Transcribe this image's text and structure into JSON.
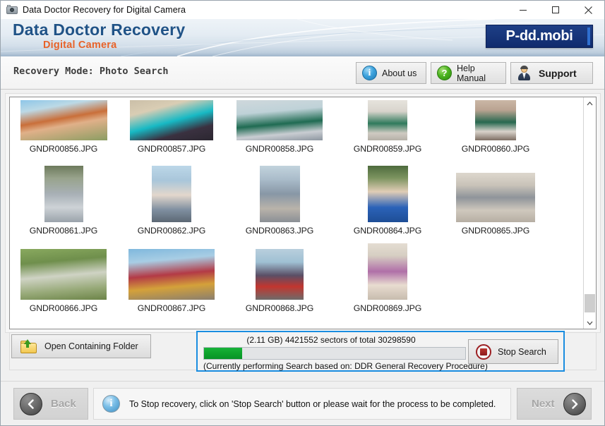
{
  "window": {
    "title": "Data Doctor Recovery for Digital Camera",
    "icon": "camera-icon",
    "minimize": "–",
    "maximize": "□",
    "close": "✕"
  },
  "brand": {
    "title": "Data Doctor Recovery",
    "subtitle": "Digital Camera",
    "logo": "P-dd.mobi",
    "title_color": "#205387",
    "subtitle_color": "#e8632a",
    "logo_bg": "#17357a"
  },
  "modebar": {
    "mode_text": "Recovery Mode: Photo Search",
    "buttons": [
      {
        "id": "about",
        "label": "About us",
        "icon": "info-icon"
      },
      {
        "id": "help",
        "label": "Help Manual",
        "icon": "question-icon"
      },
      {
        "id": "support",
        "label": "Support",
        "icon": "person-icon"
      }
    ]
  },
  "thumbnails": {
    "rows": [
      [
        {
          "name": "GNDR00856.JPG"
        },
        {
          "name": "GNDR00857.JPG"
        },
        {
          "name": "GNDR00858.JPG"
        },
        {
          "name": "GNDR00859.JPG"
        },
        {
          "name": "GNDR00860.JPG"
        }
      ],
      [
        {
          "name": "GNDR00861.JPG"
        },
        {
          "name": "GNDR00862.JPG"
        },
        {
          "name": "GNDR00863.JPG"
        },
        {
          "name": "GNDR00864.JPG"
        },
        {
          "name": "GNDR00865.JPG"
        }
      ],
      [
        {
          "name": "GNDR00866.JPG"
        },
        {
          "name": "GNDR00867.JPG"
        },
        {
          "name": "GNDR00868.JPG"
        },
        {
          "name": "GNDR00869.JPG"
        }
      ]
    ],
    "scrollbar": {
      "up": "˄",
      "down": "˅"
    }
  },
  "actions": {
    "open_folder_label": "Open Containing Folder",
    "stop_search_label": "Stop Search"
  },
  "progress": {
    "top_text": "(2.11 GB) 4421552  sectors  of  total 30298590",
    "bottom_text": "(Currently performing Search based on:  DDR General Recovery Procedure)",
    "size": "2.11 GB",
    "sectors_done": 4421552,
    "sectors_total": 30298590,
    "percent": 14.6,
    "fill_color": "#0da32c",
    "highlight_color": "#1a8de0"
  },
  "footer": {
    "back_label": "Back",
    "next_label": "Next",
    "message": "To Stop recovery, click on 'Stop Search' button or please wait for the process to be completed.",
    "message_icon": "info-icon"
  }
}
